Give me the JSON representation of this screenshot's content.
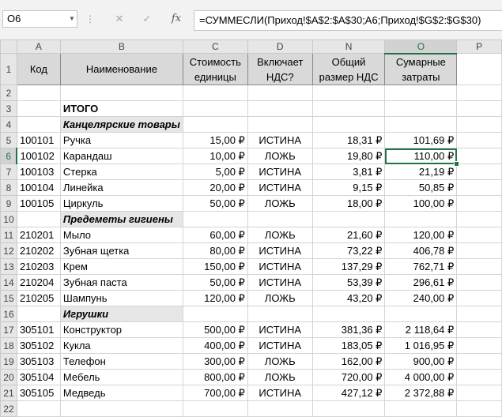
{
  "formula_bar": {
    "name_box": "O6",
    "cancel_icon": "✕",
    "enter_icon": "✓",
    "fx_label": "fx",
    "formula": "=СУММЕСЛИ(Приход!$A$2:$A$30;A6;Приход!$G$2:$G$30)"
  },
  "columns": [
    "A",
    "B",
    "C",
    "D",
    "N",
    "O",
    "P"
  ],
  "selected_column": "O",
  "selected_row": "6",
  "header": {
    "code": "Код",
    "name": "Наименование",
    "cost": "Стоимость единицы",
    "vat_incl": "Включает НДС?",
    "vat_total": "Общий размер НДС",
    "total_cost": "Сумарные затраты"
  },
  "summary_label": "ИТОГО",
  "rows": [
    {
      "row": "4",
      "kind": "category",
      "name": "Канцелярские товары"
    },
    {
      "row": "5",
      "code": "100101",
      "name": "Ручка",
      "cost": "15,00 ₽",
      "vat_incl": "ИСТИНА",
      "vat_total": "18,31 ₽",
      "total_cost": "101,69 ₽"
    },
    {
      "row": "6",
      "code": "100102",
      "name": "Карандаш",
      "cost": "10,00 ₽",
      "vat_incl": "ЛОЖЬ",
      "vat_total": "19,80 ₽",
      "total_cost": "110,00 ₽"
    },
    {
      "row": "7",
      "code": "100103",
      "name": "Стерка",
      "cost": "5,00 ₽",
      "vat_incl": "ИСТИНА",
      "vat_total": "3,81 ₽",
      "total_cost": "21,19 ₽"
    },
    {
      "row": "8",
      "code": "100104",
      "name": "Линейка",
      "cost": "20,00 ₽",
      "vat_incl": "ИСТИНА",
      "vat_total": "9,15 ₽",
      "total_cost": "50,85 ₽"
    },
    {
      "row": "9",
      "code": "100105",
      "name": "Циркуль",
      "cost": "50,00 ₽",
      "vat_incl": "ЛОЖЬ",
      "vat_total": "18,00 ₽",
      "total_cost": "100,00 ₽"
    },
    {
      "row": "10",
      "kind": "category",
      "name": "Предеметы гигиены"
    },
    {
      "row": "11",
      "code": "210201",
      "name": "Мыло",
      "cost": "60,00 ₽",
      "vat_incl": "ЛОЖЬ",
      "vat_total": "21,60 ₽",
      "total_cost": "120,00 ₽"
    },
    {
      "row": "12",
      "code": "210202",
      "name": "Зубная щетка",
      "cost": "80,00 ₽",
      "vat_incl": "ИСТИНА",
      "vat_total": "73,22 ₽",
      "total_cost": "406,78 ₽"
    },
    {
      "row": "13",
      "code": "210203",
      "name": "Крем",
      "cost": "150,00 ₽",
      "vat_incl": "ИСТИНА",
      "vat_total": "137,29 ₽",
      "total_cost": "762,71 ₽"
    },
    {
      "row": "14",
      "code": "210204",
      "name": "Зубная паста",
      "cost": "50,00 ₽",
      "vat_incl": "ИСТИНА",
      "vat_total": "53,39 ₽",
      "total_cost": "296,61 ₽"
    },
    {
      "row": "15",
      "code": "210205",
      "name": "Шампунь",
      "cost": "120,00 ₽",
      "vat_incl": "ЛОЖЬ",
      "vat_total": "43,20 ₽",
      "total_cost": "240,00 ₽"
    },
    {
      "row": "16",
      "kind": "category",
      "name": "Игрушки"
    },
    {
      "row": "17",
      "code": "305101",
      "name": "Конструктор",
      "cost": "500,00 ₽",
      "vat_incl": "ИСТИНА",
      "vat_total": "381,36 ₽",
      "total_cost": "2 118,64 ₽"
    },
    {
      "row": "18",
      "code": "305102",
      "name": "Кукла",
      "cost": "400,00 ₽",
      "vat_incl": "ИСТИНА",
      "vat_total": "183,05 ₽",
      "total_cost": "1 016,95 ₽"
    },
    {
      "row": "19",
      "code": "305103",
      "name": "Телефон",
      "cost": "300,00 ₽",
      "vat_incl": "ЛОЖЬ",
      "vat_total": "162,00 ₽",
      "total_cost": "900,00 ₽"
    },
    {
      "row": "20",
      "code": "305104",
      "name": "Мебель",
      "cost": "800,00 ₽",
      "vat_incl": "ЛОЖЬ",
      "vat_total": "720,00 ₽",
      "total_cost": "4 000,00 ₽"
    },
    {
      "row": "21",
      "code": "305105",
      "name": "Медведь",
      "cost": "700,00 ₽",
      "vat_incl": "ИСТИНА",
      "vat_total": "427,12 ₽",
      "total_cost": "2 372,88 ₽"
    },
    {
      "row": "22",
      "kind": "empty"
    }
  ]
}
